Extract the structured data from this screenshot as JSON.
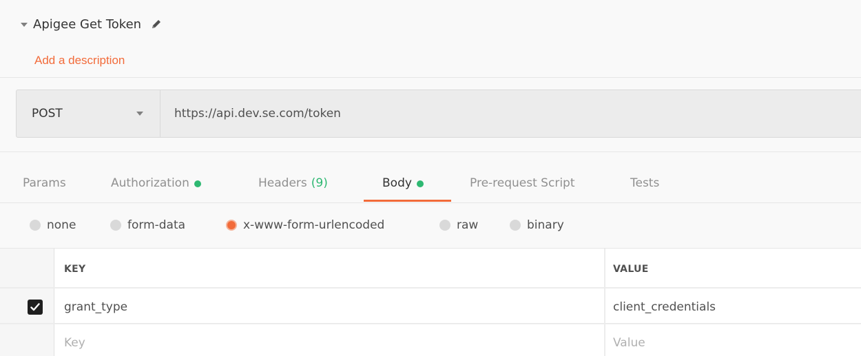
{
  "request": {
    "name": "Apigee Get Token",
    "description_link": "Add a description",
    "method": "POST",
    "url": "https://api.dev.se.com/token"
  },
  "tabs": {
    "params": "Params",
    "authorization": "Authorization",
    "headers": "Headers",
    "headers_count": "(9)",
    "body": "Body",
    "prerequest": "Pre-request Script",
    "tests": "Tests"
  },
  "body_types": {
    "none": "none",
    "form_data": "form-data",
    "urlencoded": "x-www-form-urlencoded",
    "raw": "raw",
    "binary": "binary",
    "selected": "x-www-form-urlencoded"
  },
  "kv_table": {
    "header_key": "KEY",
    "header_value": "VALUE",
    "rows": [
      {
        "key": "grant_type",
        "value": "client_credentials",
        "checked": true
      }
    ],
    "placeholder_key": "Key",
    "placeholder_value": "Value"
  },
  "colors": {
    "accent": "#f26b3a",
    "status_green": "#2eb872"
  }
}
